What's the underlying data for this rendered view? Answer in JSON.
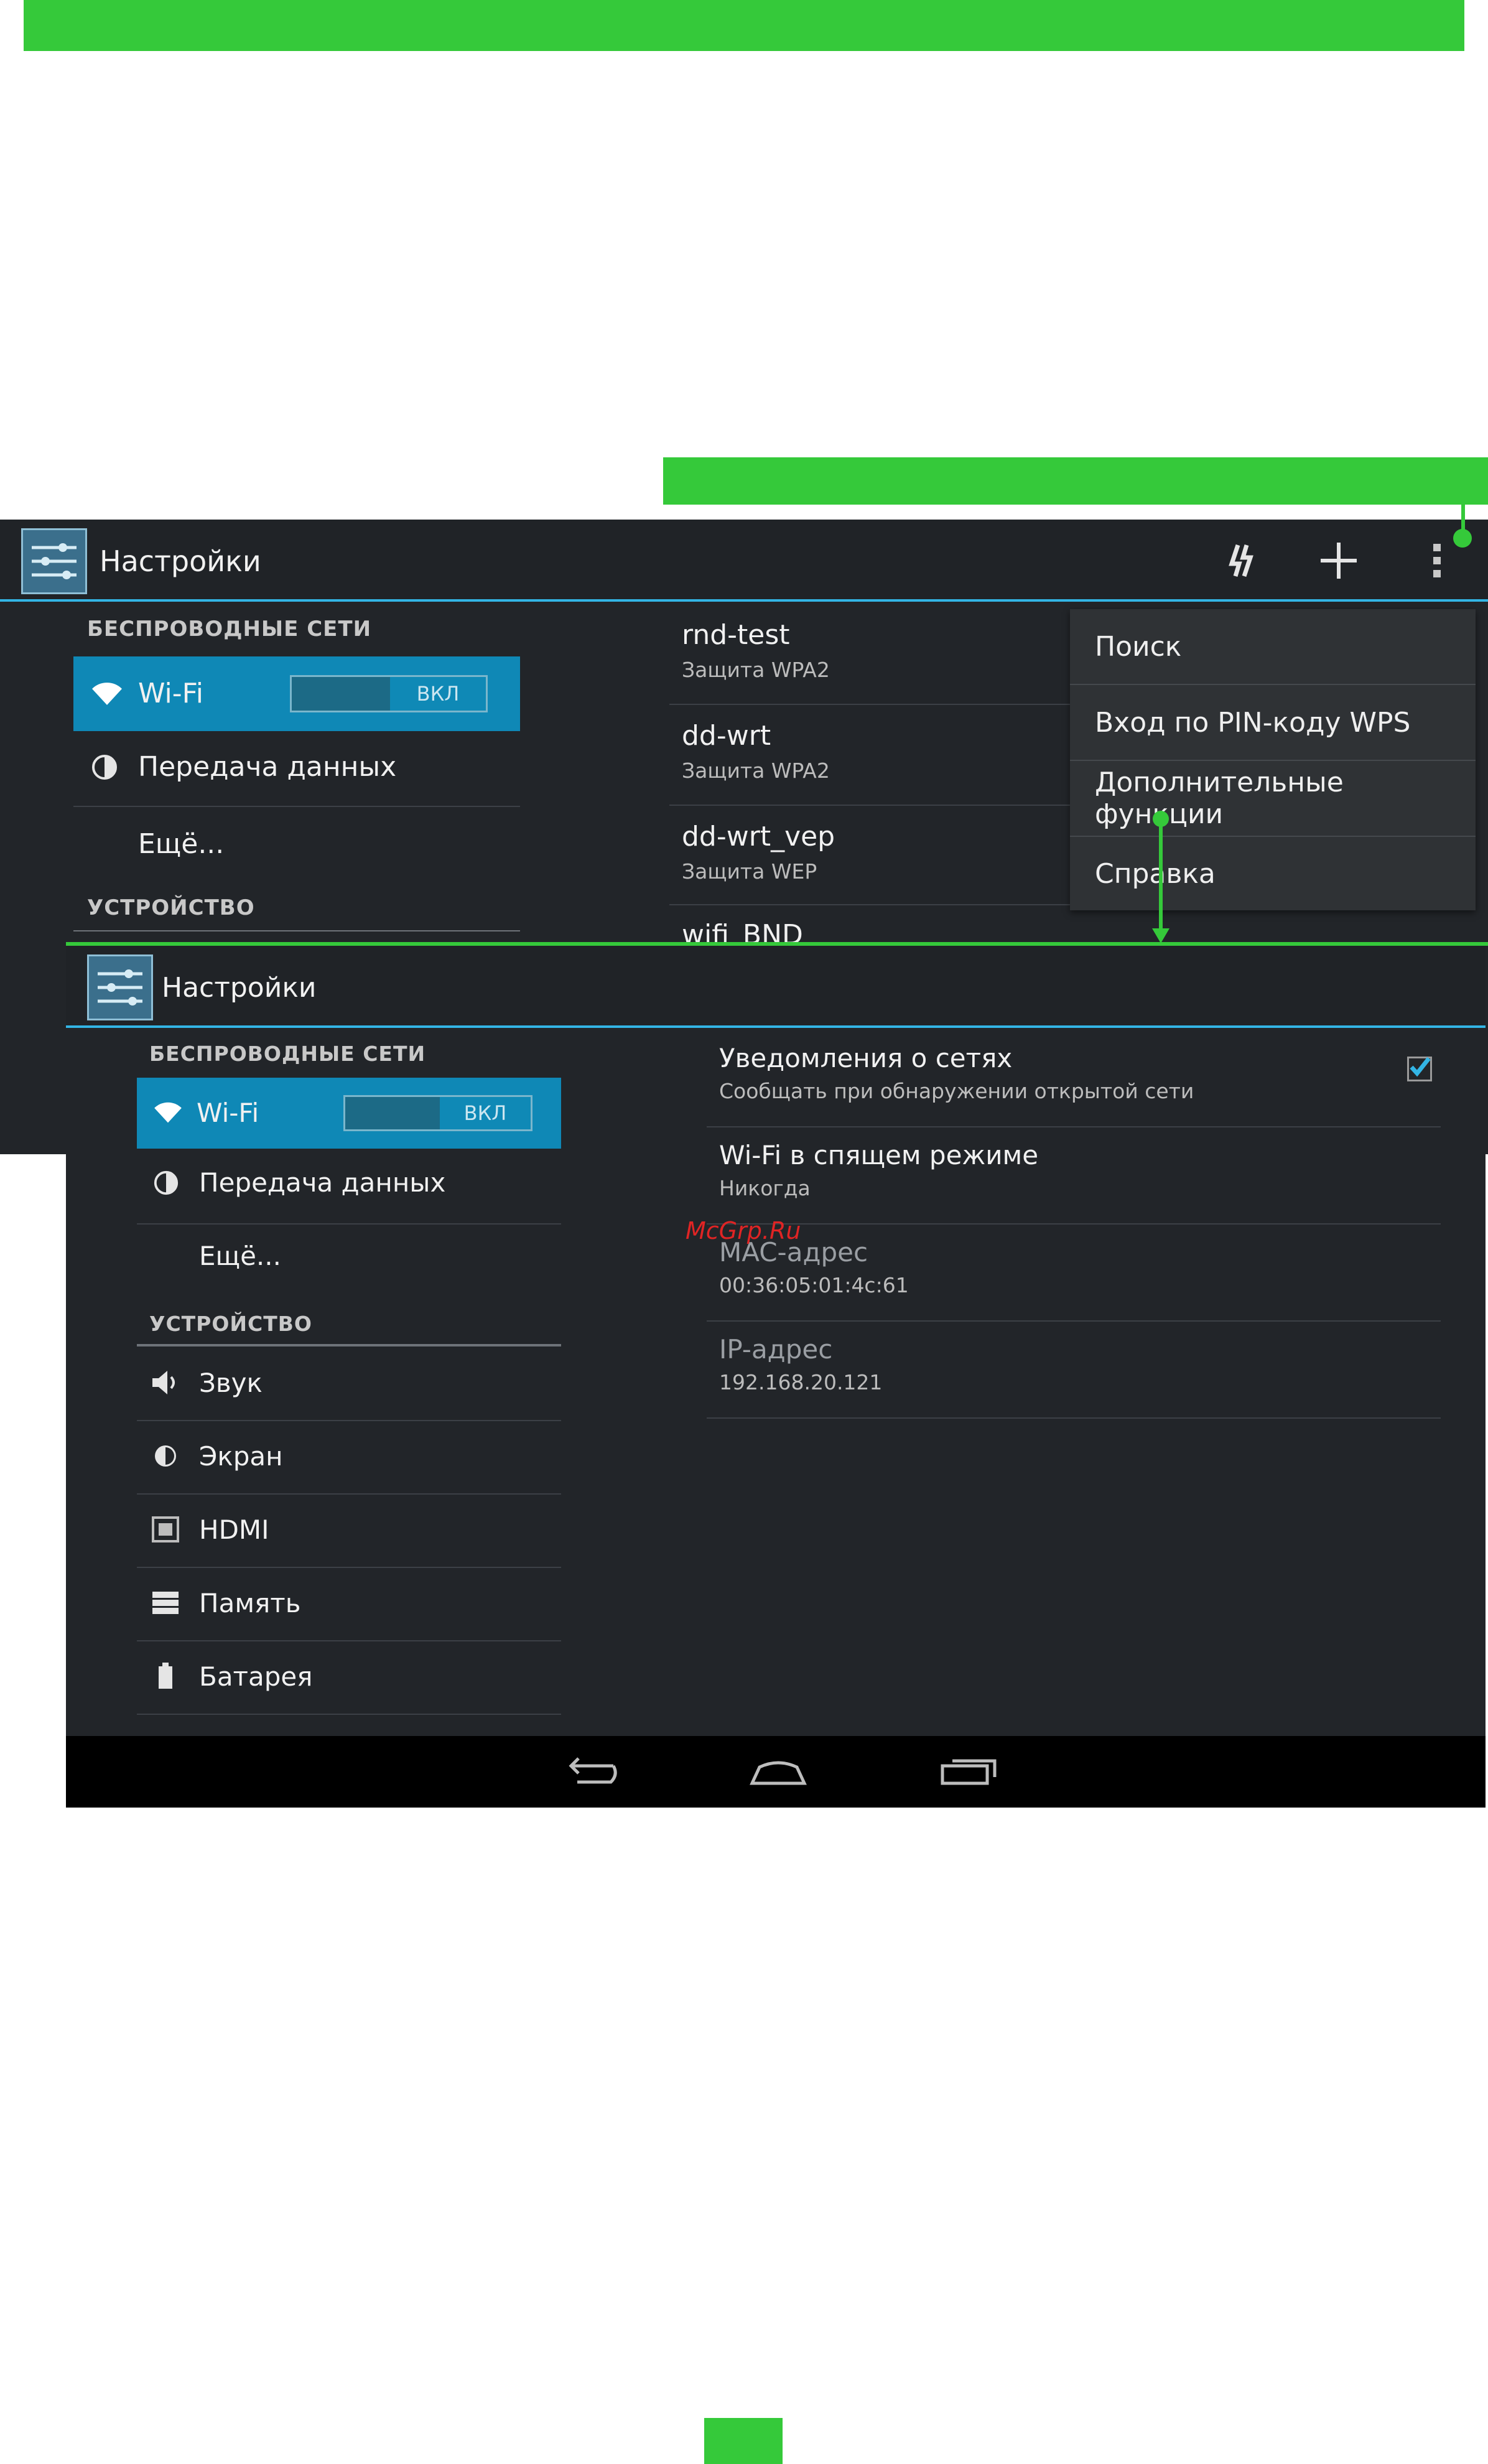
{
  "colors": {
    "accent_green": "#35c93a",
    "holo_blue": "#33b5e5",
    "wifi_row": "#0f88b6",
    "bg_dark": "#222529"
  },
  "screen1": {
    "title": "Настройки",
    "actions": {
      "refresh_icon": "refresh-icon",
      "add_icon": "add-icon",
      "overflow_icon": "overflow-menu-icon"
    },
    "sidebar": {
      "section_wireless": "БЕСПРОВОДНЫЕ СЕТИ",
      "wifi_label": "Wi-Fi",
      "wifi_toggle": "ВКЛ",
      "data_label": "Передача данных",
      "more_label": "Ещё...",
      "section_device": "УСТРОЙСТВО"
    },
    "networks": [
      {
        "name": "rnd-test",
        "security": "Защита WPA2"
      },
      {
        "name": "dd-wrt",
        "security": "Защита WPA2"
      },
      {
        "name": "dd-wrt_vep",
        "security": "Защита WEP"
      },
      {
        "name": "wifi_BND",
        "security": ""
      }
    ],
    "menu": [
      "Поиск",
      "Вход по PIN-коду WPS",
      "Дополнительные функции",
      "Справка"
    ]
  },
  "screen2": {
    "title": "Настройки",
    "sidebar": {
      "section_wireless": "БЕСПРОВОДНЫЕ СЕТИ",
      "wifi_label": "Wi-Fi",
      "wifi_toggle": "ВКЛ",
      "data_label": "Передача данных",
      "more_label": "Ещё...",
      "section_device": "УСТРОЙСТВО",
      "device_items": [
        {
          "label": "Звук",
          "icon": "volume-icon"
        },
        {
          "label": "Экран",
          "icon": "brightness-icon"
        },
        {
          "label": "HDMI",
          "icon": "hdmi-icon"
        },
        {
          "label": "Память",
          "icon": "storage-icon"
        },
        {
          "label": "Батарея",
          "icon": "battery-icon"
        }
      ]
    },
    "advanced": [
      {
        "title": "Уведомления о сетях",
        "summary": "Сообщать при обнаружении открытой сети",
        "checked": true
      },
      {
        "title": "Wi-Fi в спящем режиме",
        "summary": "Никогда"
      },
      {
        "title": "MAC-адрес",
        "summary": "00:36:05:01:4c:61"
      },
      {
        "title": "IP-адрес",
        "summary": "192.168.20.121"
      }
    ],
    "watermark": "McGrp.Ru",
    "navbar": {
      "back_icon": "back-icon",
      "home_icon": "home-icon",
      "recent_icon": "recent-apps-icon"
    }
  }
}
